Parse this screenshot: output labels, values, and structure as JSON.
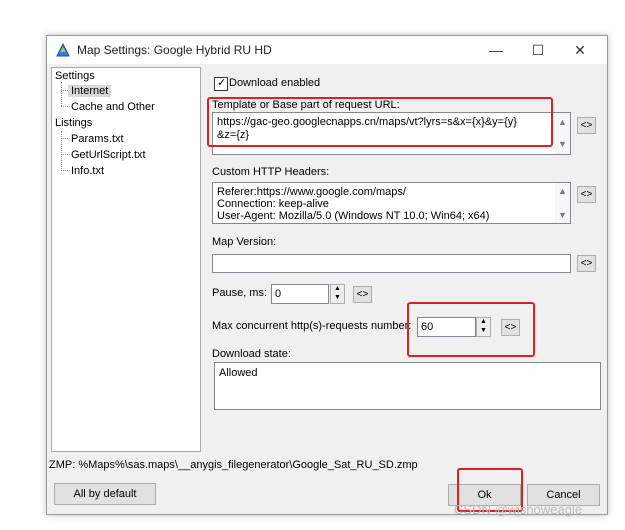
{
  "window": {
    "title": "Map Settings: Google Hybrid RU HD",
    "minimize_symbol": "—",
    "maximize_symbol": "☐",
    "close_symbol": "✕"
  },
  "tree": {
    "settings": "Settings",
    "internet": "Internet",
    "cache_and_other": "Cache and Other",
    "listings": "Listings",
    "params": "Params.txt",
    "get_url_script": "GetUrlScript.txt",
    "info": "Info.txt"
  },
  "download_enabled": {
    "label": "Download enabled",
    "checked": true
  },
  "url_template": {
    "label": "Template or Base part of request URL:",
    "line1": "https://gac-geo.googlecnapps.cn/maps/vt?lyrs=s&x={x}&y={y}",
    "line2": "&z={z}"
  },
  "headers": {
    "label": "Custom HTTP Headers:",
    "line1": "Referer:https://www.google.com/maps/",
    "line2": "Connection: keep-alive",
    "line3": "User-Agent: Mozilla/5.0 (Windows NT 10.0; Win64; x64)"
  },
  "map_version": {
    "label": "Map Version:",
    "value": ""
  },
  "pause": {
    "label": "Pause, ms:",
    "value": "0"
  },
  "max_requests": {
    "label": "Max concurrent http(s)-requests number:",
    "value": "60"
  },
  "download_state": {
    "label": "Download state:",
    "value": "Allowed"
  },
  "reset_button": "<>",
  "zmp_path": "ZMP:  %Maps%\\sas.maps\\__anygis_filegenerator\\Google_Sat_RU_SD.zmp",
  "buttons": {
    "all_by_default": "All by default",
    "ok": "Ok",
    "cancel": "Cancel"
  },
  "watermark": "CSDN @wjsnoweagle",
  "colors": {
    "highlight": "#e02020",
    "selected": "#d9d9d9"
  }
}
